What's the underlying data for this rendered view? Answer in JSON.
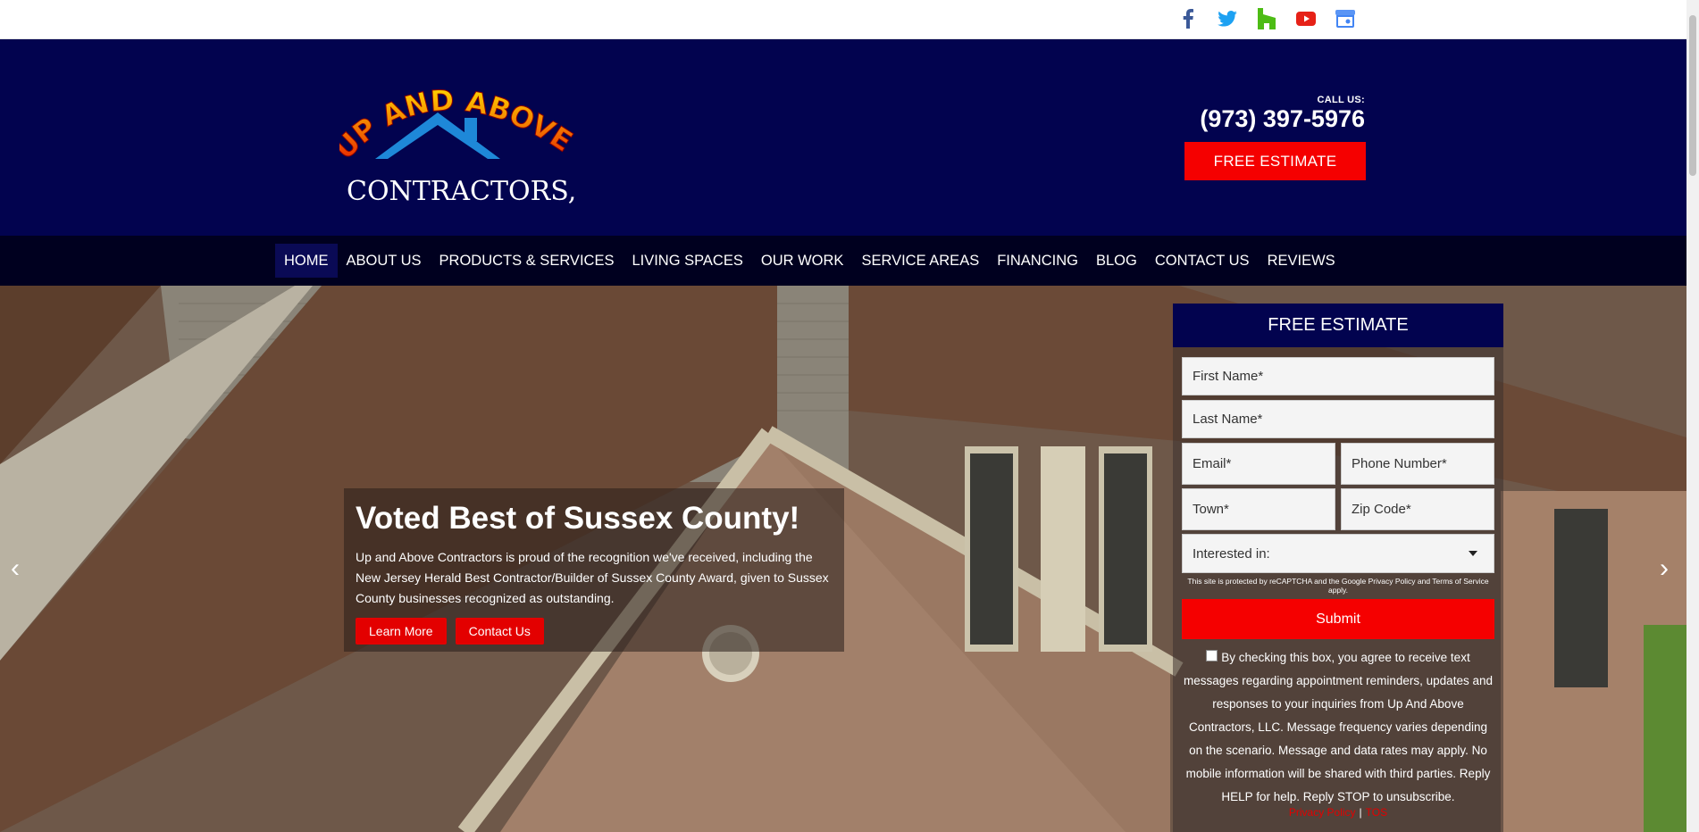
{
  "social": {
    "icons": [
      "facebook-icon",
      "twitter-icon",
      "houzz-icon",
      "youtube-icon",
      "google-business-icon"
    ],
    "colors": {
      "facebook": "#3b5998",
      "twitter": "#1da1f2",
      "houzz": "#4dbc15",
      "youtube": "#e62117",
      "google": "#4285f4"
    }
  },
  "header": {
    "logo_line1": "UP AND ABOVE",
    "logo_line2": "CONTRACTORS, LLC",
    "call_label": "CALL US:",
    "phone": "(973) 397-5976",
    "estimate_button": "FREE ESTIMATE"
  },
  "nav": {
    "items": [
      "HOME",
      "ABOUT US",
      "PRODUCTS & SERVICES",
      "LIVING SPACES",
      "OUR WORK",
      "SERVICE AREAS",
      "FINANCING",
      "BLOG",
      "CONTACT US",
      "REVIEWS"
    ],
    "active": "HOME"
  },
  "hero": {
    "heading": "Voted Best of Sussex County!",
    "text": "Up and Above Contractors is proud of the recognition we've received, including the New Jersey Herald Best Contractor/Builder of Sussex County Award, given to Sussex County businesses recognized as outstanding.",
    "learn_more": "Learn More",
    "contact_us": "Contact Us",
    "prev_arrow": "‹",
    "next_arrow": "›"
  },
  "form": {
    "title": "FREE ESTIMATE",
    "first_name": "First Name*",
    "last_name": "Last Name*",
    "email": "Email*",
    "phone": "Phone Number*",
    "town": "Town*",
    "zip": "Zip Code*",
    "interested": "Interested in:",
    "recaptcha": "This site is protected by reCAPTCHA and the Google Privacy Policy and Terms of Service apply.",
    "submit": "Submit",
    "consent": "By checking this box, you agree to receive text messages regarding appointment reminders, updates and responses to your inquiries from Up And Above Contractors, LLC. Message frequency varies depending on the scenario. Message and data rates may apply. No mobile information will be shared with third parties. Reply HELP for help. Reply STOP to unsubscribe.",
    "privacy": "Privacy Policy",
    "separator": "|",
    "tos": "TOS"
  },
  "colors": {
    "header_bg": "#02034f",
    "nav_bg": "#00001f",
    "accent_red": "#f50000"
  }
}
